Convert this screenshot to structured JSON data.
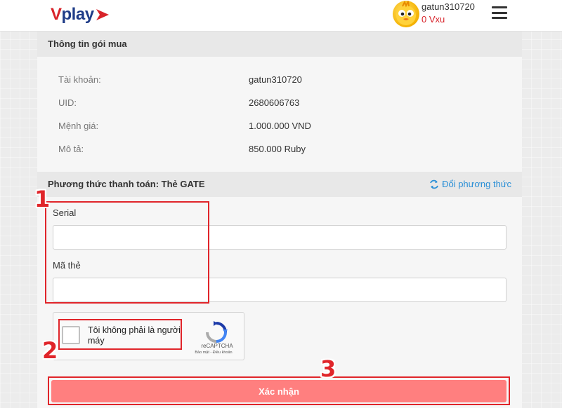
{
  "header": {
    "logo": {
      "v": "V",
      "rest": "play"
    },
    "user": {
      "name": "gatun310720",
      "balance": "0 Vxu"
    }
  },
  "package_info": {
    "title": "Thông tin gói mua",
    "rows": [
      {
        "label": "Tài khoản:",
        "value": "gatun310720"
      },
      {
        "label": "UID:",
        "value": "2680606763"
      },
      {
        "label": "Mệnh giá:",
        "value": "1.000.000 VND"
      },
      {
        "label": "Mô tả:",
        "value": "850.000 Ruby"
      }
    ]
  },
  "payment": {
    "title": "Phương thức thanh toán: Thẻ GATE",
    "change_label": "Đổi phương thức",
    "serial_label": "Serial",
    "serial_value": "",
    "code_label": "Mã thẻ",
    "code_value": ""
  },
  "captcha": {
    "text": "Tôi không phải là người máy",
    "brand": "reCAPTCHA",
    "links": "Bảo mật - Điều khoản"
  },
  "submit_label": "Xác nhận",
  "annotations": {
    "one": "1",
    "two": "2",
    "three": "3"
  },
  "colors": {
    "accent_red": "#e0252a",
    "link_blue": "#2a8fd6",
    "button_pink": "#ff7f7f",
    "logo_blue": "#1f3c88"
  }
}
